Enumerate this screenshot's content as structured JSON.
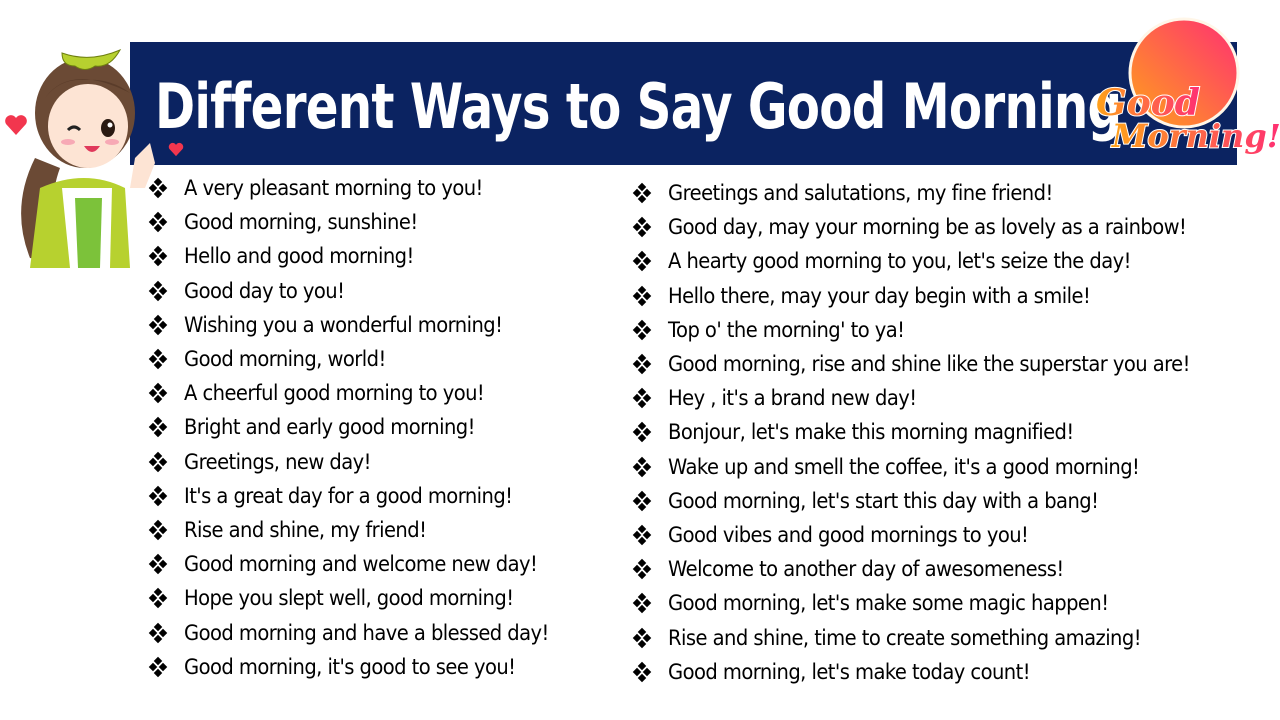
{
  "header": {
    "title": "Different Ways to Say Good Morning",
    "logo_line1": "Good",
    "logo_line2": "Morning!",
    "banner_color": "#0b2361",
    "logo_sun_gradient": [
      "#ffa21a",
      "#ff3d6e"
    ]
  },
  "bullet_icon": "four-diamond-bullet",
  "left_list": [
    "A very pleasant morning to you!",
    "Good morning, sunshine!",
    "Hello and good morning!",
    "Good day to you!",
    "Wishing you a wonderful morning!",
    "Good morning, world!",
    "A cheerful good morning to you!",
    "Bright and early good morning!",
    "Greetings, new day!",
    "It's a great day for a good morning!",
    "Rise and shine, my friend!",
    "Good morning and welcome new day!",
    "Hope you slept well, good morning!",
    "Good morning and have a blessed day!",
    "Good morning, it's good to see you!"
  ],
  "right_list": [
    "Greetings and salutations, my fine friend!",
    "Good day, may your morning be as lovely as a rainbow!",
    "A hearty good morning to you, let's seize the day!",
    "Hello there, may your day begin with a smile!",
    "Top o' the morning' to ya!",
    "Good morning, rise and shine like the superstar you are!",
    "Hey , it's a brand new day!",
    "Bonjour, let's make this morning magnified!",
    "Wake up and smell the coffee, it's a good morning!",
    "Good morning, let's start this day with a bang!",
    "Good vibes and good mornings to you!",
    "Welcome to another day of awesomeness!",
    "Good morning, let's make some magic happen!",
    "Rise and shine, time to create something amazing!",
    "Good morning, let's make today count!"
  ]
}
